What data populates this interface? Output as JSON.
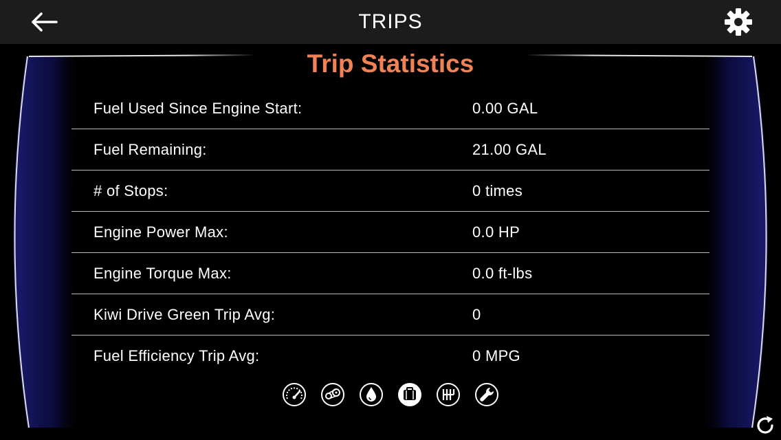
{
  "header": {
    "title": "TRIPS",
    "back_icon": "arrow-left-icon",
    "settings_icon": "gear-icon"
  },
  "main": {
    "title": "Trip Statistics",
    "title_color": "#f08255",
    "stats": [
      {
        "label": "Fuel Used Since Engine Start:",
        "value": "0.00 GAL"
      },
      {
        "label": "Fuel Remaining:",
        "value": "21.00 GAL"
      },
      {
        "label": "# of Stops:",
        "value": "0 times"
      },
      {
        "label": "Engine Power Max:",
        "value": "0.0 HP"
      },
      {
        "label": "Engine Torque Max:",
        "value": "0.0 ft-lbs"
      },
      {
        "label": "Kiwi Drive Green Trip Avg:",
        "value": "0"
      },
      {
        "label": "Fuel Efficiency Trip Avg:",
        "value": "0 MPG"
      }
    ]
  },
  "gauge_tabs": [
    {
      "icon": "speedometer-icon",
      "selected": false
    },
    {
      "icon": "drivetrain-icon",
      "selected": false
    },
    {
      "icon": "fuel-drop-icon",
      "selected": false
    },
    {
      "icon": "luggage-icon",
      "selected": true
    },
    {
      "icon": "gear-shift-icon",
      "selected": false
    },
    {
      "icon": "wrench-icon",
      "selected": false
    }
  ],
  "footer": {
    "refresh_icon": "refresh-icon"
  },
  "colors": {
    "accent": "#f08255",
    "navbar_bg": "#1c1c1c",
    "frame_glow": "#1a1a7a"
  }
}
